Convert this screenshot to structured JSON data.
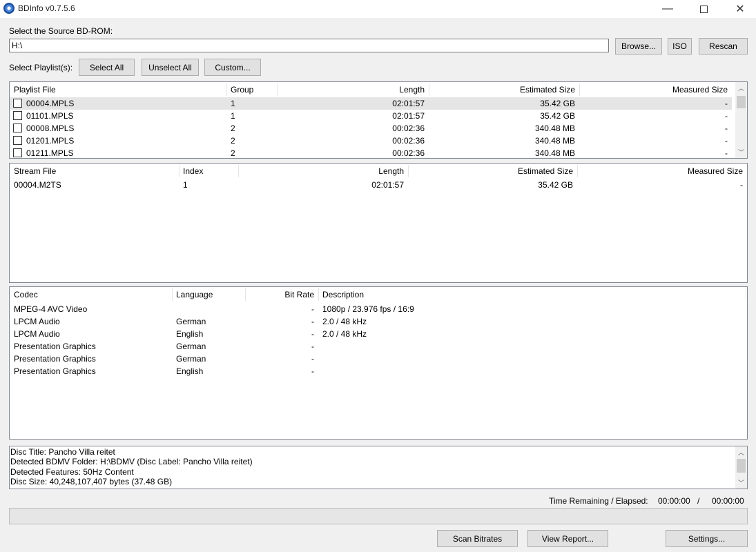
{
  "window": {
    "title": "BDInfo v0.7.5.6",
    "minimize_glyph": "—",
    "close_glyph": "✕"
  },
  "source": {
    "label": "Select the Source BD-ROM:",
    "path_value": "H:\\",
    "browse_label": "Browse...",
    "iso_label": "ISO",
    "rescan_label": "Rescan"
  },
  "playlist_controls": {
    "label": "Select Playlist(s):",
    "select_all_label": "Select All",
    "unselect_all_label": "Unselect All",
    "custom_label": "Custom..."
  },
  "playlists": {
    "columns": [
      "Playlist File",
      "Group",
      "Length",
      "Estimated Size",
      "Measured Size"
    ],
    "rows": [
      {
        "file": "00004.MPLS",
        "group": "1",
        "length": "02:01:57",
        "est": "35.42 GB",
        "measured": "-"
      },
      {
        "file": "01101.MPLS",
        "group": "1",
        "length": "02:01:57",
        "est": "35.42 GB",
        "measured": "-"
      },
      {
        "file": "00008.MPLS",
        "group": "2",
        "length": "00:02:36",
        "est": "340.48 MB",
        "measured": "-"
      },
      {
        "file": "01201.MPLS",
        "group": "2",
        "length": "00:02:36",
        "est": "340.48 MB",
        "measured": "-"
      },
      {
        "file": "01211.MPLS",
        "group": "2",
        "length": "00:02:36",
        "est": "340.48 MB",
        "measured": "-"
      }
    ]
  },
  "streams": {
    "columns": [
      "Stream File",
      "Index",
      "Length",
      "Estimated Size",
      "Measured Size"
    ],
    "rows": [
      {
        "file": "00004.M2TS",
        "index": "1",
        "length": "02:01:57",
        "est": "35.42 GB",
        "measured": "-"
      }
    ]
  },
  "codecs": {
    "columns": [
      "Codec",
      "Language",
      "Bit Rate",
      "Description"
    ],
    "rows": [
      {
        "codec": "MPEG-4 AVC Video",
        "language": "",
        "bitrate": "-",
        "desc": "1080p / 23.976 fps / 16:9"
      },
      {
        "codec": "LPCM Audio",
        "language": "German",
        "bitrate": "-",
        "desc": "2.0 / 48 kHz"
      },
      {
        "codec": "LPCM Audio",
        "language": "English",
        "bitrate": "-",
        "desc": "2.0 / 48 kHz"
      },
      {
        "codec": "Presentation Graphics",
        "language": "German",
        "bitrate": "-",
        "desc": ""
      },
      {
        "codec": "Presentation Graphics",
        "language": "German",
        "bitrate": "-",
        "desc": ""
      },
      {
        "codec": "Presentation Graphics",
        "language": "English",
        "bitrate": "-",
        "desc": ""
      }
    ]
  },
  "disc_info": [
    "Disc Title: Pancho Villa reitet",
    "Detected BDMV Folder: H:\\BDMV (Disc Label: Pancho Villa reitet)",
    "Detected Features: 50Hz Content",
    "Disc Size: 40,248,107,407 bytes (37.48 GB)"
  ],
  "time": {
    "label": "Time Remaining / Elapsed:",
    "remaining": "00:00:00",
    "separator": "/",
    "elapsed": "00:00:00"
  },
  "progress_fraction": 0,
  "footer": {
    "scan_label": "Scan Bitrates",
    "report_label": "View Report...",
    "settings_label": "Settings..."
  },
  "scroll_glyphs": {
    "up": "︿",
    "down": "﹀"
  },
  "colors": {
    "selected_row": "#e5e5e5",
    "scroll_thumb": "#cdcdcd"
  }
}
